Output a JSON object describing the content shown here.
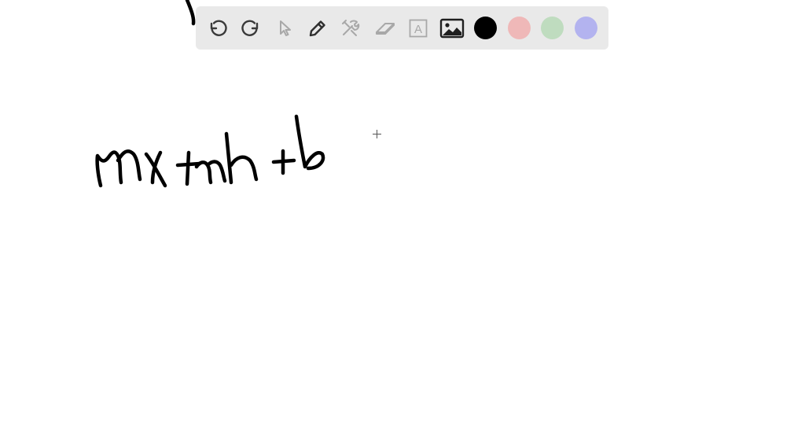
{
  "toolbar": {
    "tools": [
      {
        "id": "undo",
        "icon": "undo-icon"
      },
      {
        "id": "redo",
        "icon": "redo-icon"
      },
      {
        "id": "select",
        "icon": "pointer-icon"
      },
      {
        "id": "pen",
        "icon": "pen-icon"
      },
      {
        "id": "tools",
        "icon": "tools-icon"
      },
      {
        "id": "eraser",
        "icon": "eraser-icon"
      },
      {
        "id": "text",
        "icon": "text-box-icon",
        "glyph": "A"
      },
      {
        "id": "image",
        "icon": "image-icon"
      }
    ],
    "colors": [
      {
        "name": "black",
        "hex": "#000000",
        "selected": true
      },
      {
        "name": "pink",
        "hex": "#efb8b8",
        "selected": false
      },
      {
        "name": "green",
        "hex": "#bfdcbf",
        "selected": false
      },
      {
        "name": "purple",
        "hex": "#b3b3ef",
        "selected": false
      }
    ]
  },
  "canvas": {
    "background": "#ffffff",
    "ink_color": "#000000"
  }
}
